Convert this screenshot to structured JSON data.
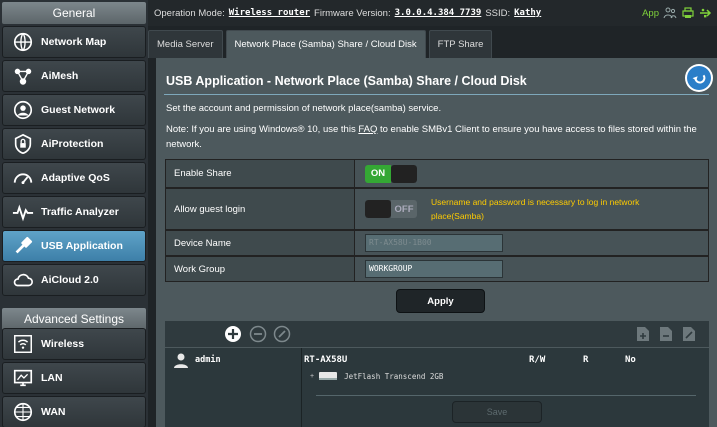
{
  "sidebar": {
    "general_label": "General",
    "advanced_label": "Advanced Settings",
    "items": [
      {
        "label": "Network Map"
      },
      {
        "label": "AiMesh"
      },
      {
        "label": "Guest Network"
      },
      {
        "label": "AiProtection"
      },
      {
        "label": "Adaptive QoS"
      },
      {
        "label": "Traffic Analyzer"
      },
      {
        "label": "USB Application"
      },
      {
        "label": "AiCloud 2.0"
      }
    ],
    "advanced_items": [
      {
        "label": "Wireless"
      },
      {
        "label": "LAN"
      },
      {
        "label": "WAN"
      }
    ]
  },
  "topbar": {
    "op_mode_label": "Operation Mode:",
    "op_mode_value": "Wireless router",
    "fw_label": "Firmware Version:",
    "fw_value": "3.0.0.4.384_7739",
    "ssid_label": "SSID:",
    "ssid_value": "Kathy",
    "app_label": "App"
  },
  "tabs": [
    {
      "label": "Media Server"
    },
    {
      "label": "Network Place (Samba) Share / Cloud Disk"
    },
    {
      "label": "FTP Share"
    }
  ],
  "main": {
    "title": "USB Application - Network Place (Samba) Share / Cloud Disk",
    "desc1": "Set the account and permission of network place(samba) service.",
    "note_prefix": "Note: If you are using Windows® 10, use this ",
    "note_link": "FAQ",
    "note_suffix": " to enable SMBv1 Client to ensure you have access to files stored within the network.",
    "fields": {
      "enable_share_label": "Enable Share",
      "enable_share_state": "ON",
      "guest_login_label": "Allow guest login",
      "guest_login_state": "OFF",
      "guest_hint": "Username and password is necessary to log in network place(Samba)",
      "device_name_label": "Device Name",
      "device_name_value": "RT-AX58U-1B00",
      "work_group_label": "Work Group",
      "work_group_value": "WORKGROUP"
    },
    "apply_label": "Apply",
    "share": {
      "user": "admin",
      "device": "RT-AX58U",
      "col_rw": "R/W",
      "col_r": "R",
      "col_no": "No",
      "drive": "JetFlash Transcend 2GB",
      "save_label": "Save"
    }
  },
  "colors": {
    "accent_active": "#4a8fb9",
    "toggle_on": "#34a734",
    "hint": "#ffcc00",
    "app_green": "#7fd13b"
  }
}
